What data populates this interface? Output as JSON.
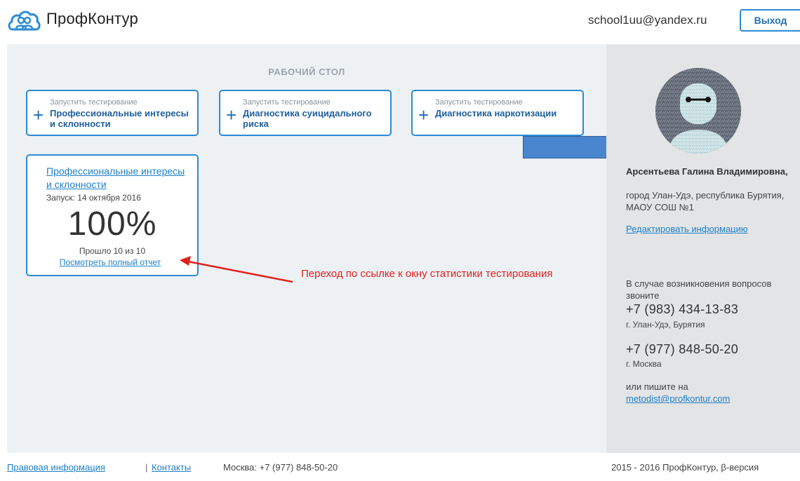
{
  "header": {
    "logo_text": "ПрофКонтур",
    "user_email": "school1uu@yandex.ru",
    "logout_label": "Выход"
  },
  "main": {
    "title": "РАБОЧИЙ СТОЛ",
    "launch_cards": [
      {
        "caption": "Запустить тестирование",
        "title": "Профессиональные интересы и склонности"
      },
      {
        "caption": "Запустить тестирование",
        "title": "Диагностика суицидального риска"
      },
      {
        "caption": "Запустить тестирование",
        "title": "Диагностика наркотизации"
      }
    ],
    "result_card": {
      "title": "Профессиональные интересы и склонности",
      "date": "Запуск: 14 октября 2016",
      "percent": "100%",
      "progress_fraction": 1.0,
      "count": "Прошло 10 из 10",
      "report_link": "Посмотреть полный отчет"
    },
    "annotation": "Переход по ссылке к окну статистики тестирования"
  },
  "sidebar": {
    "name": "Арсентьева Галина Владимировна,",
    "location": "город Улан-Удэ, республика Бурятия, МАОУ СОШ №1",
    "edit_link": "Редактировать информацию",
    "contact_intro": "В случае возникновения вопросов звоните",
    "phone1": "+7 (983) 434-13-83",
    "city1": "г. Улан-Удэ, Бурятия",
    "phone2": "+7 (977) 848-50-20",
    "city2": "г. Москва",
    "write_text": "или пишите на",
    "email": "metodist@profkontur.com"
  },
  "footer": {
    "legal_link": "Правовая информация",
    "separator": "|",
    "contacts_link": "Контакты",
    "phone": "Москва: +7 (977) 848-50-20",
    "copyright": "2015 - 2016 ПрофКонтур, β-версия"
  },
  "colors": {
    "accent": "#2b8bd6",
    "link": "#1f80c8",
    "annotation": "#e0221f",
    "main_bg": "#eef1f4",
    "sidebar_bg": "#e2e4e6"
  }
}
